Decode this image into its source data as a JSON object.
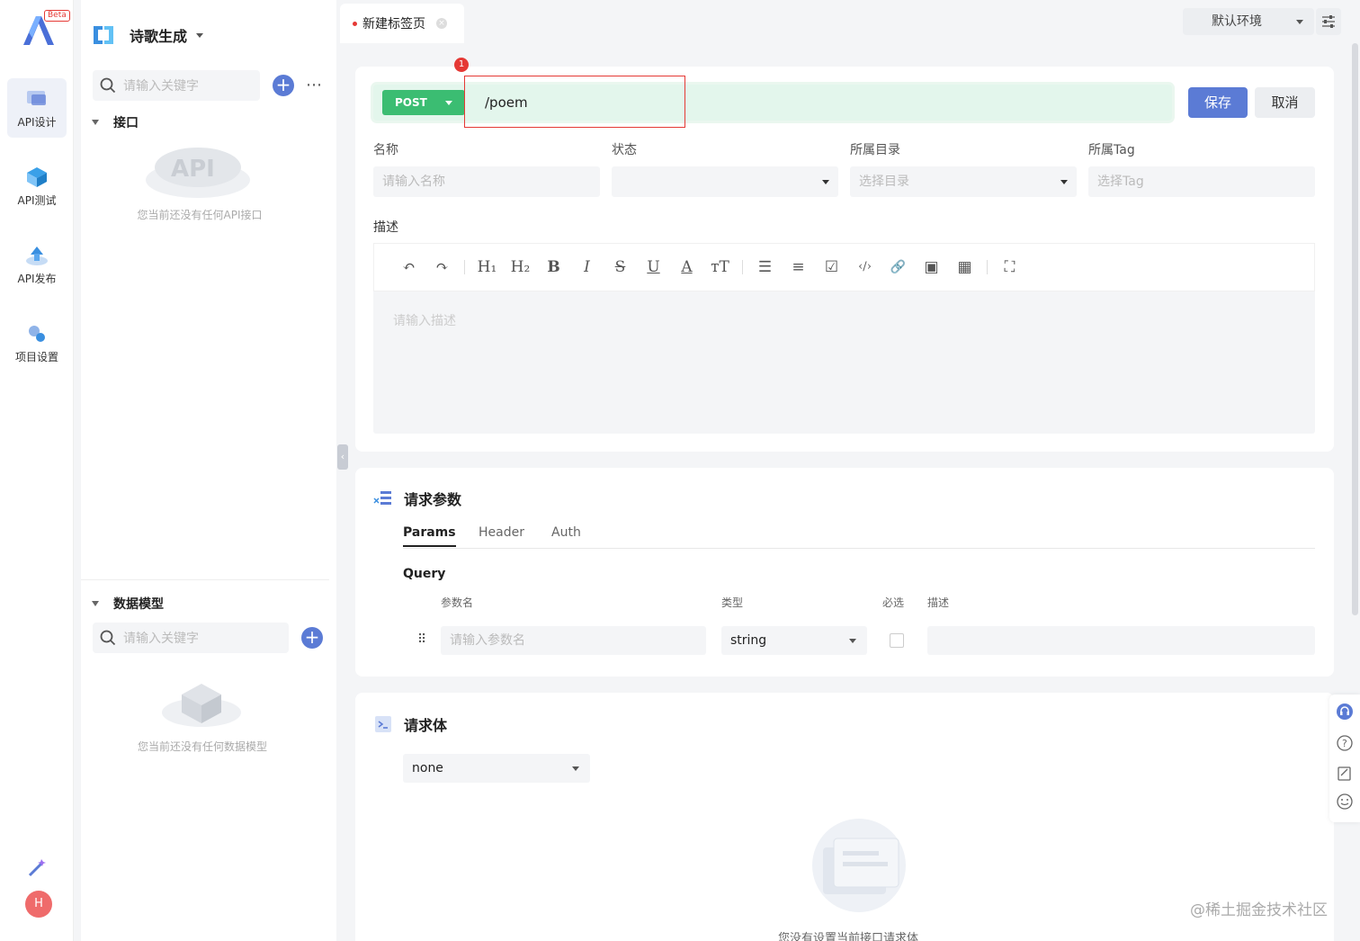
{
  "rail": {
    "beta": "Beta",
    "items": [
      {
        "label": "API设计",
        "icon": "api-design-icon"
      },
      {
        "label": "API测试",
        "icon": "api-test-icon"
      },
      {
        "label": "API发布",
        "icon": "api-publish-icon"
      },
      {
        "label": "项目设置",
        "icon": "project-settings-icon"
      }
    ],
    "avatar": "H"
  },
  "sidebar": {
    "project_name": "诗歌生成",
    "api_search_placeholder": "请输入关键字",
    "api_section": "接口",
    "api_empty": "您当前还没有任何API接口",
    "model_section": "数据模型",
    "model_search_placeholder": "请输入关键字",
    "model_empty": "您当前还没有任何数据模型"
  },
  "tabbar": {
    "tab_label": "新建标签页",
    "env": "默认环境"
  },
  "request": {
    "method": "POST",
    "path": "/poem",
    "badge": "1",
    "save": "保存",
    "cancel": "取消",
    "fields": {
      "name_label": "名称",
      "name_placeholder": "请输入名称",
      "status_label": "状态",
      "status_value": "",
      "dir_label": "所属目录",
      "dir_placeholder": "选择目录",
      "tag_label": "所属Tag",
      "tag_placeholder": "选择Tag"
    },
    "desc_label": "描述",
    "desc_placeholder": "请输入描述",
    "toolbar": [
      "↶",
      "↷",
      "H₁",
      "H₂",
      "B",
      "I",
      "S",
      "U",
      "A",
      "тT",
      "☰",
      "≡",
      "☑",
      "‹/›",
      "🔗",
      "▣",
      "▦",
      "⛶"
    ]
  },
  "params": {
    "title": "请求参数",
    "tabs": [
      "Params",
      "Header",
      "Auth"
    ],
    "query_title": "Query",
    "columns": {
      "name": "参数名",
      "type": "类型",
      "required": "必选",
      "desc": "描述"
    },
    "row": {
      "name_placeholder": "请输入参数名",
      "type": "string",
      "required": false
    }
  },
  "body": {
    "title": "请求体",
    "type": "none",
    "empty": "您没有设置当前接口请求体"
  },
  "watermark": "@稀土掘金技术社区",
  "colors": {
    "primary": "#5b7bd5",
    "post": "#3bbd72",
    "highlight": "#e53935"
  }
}
